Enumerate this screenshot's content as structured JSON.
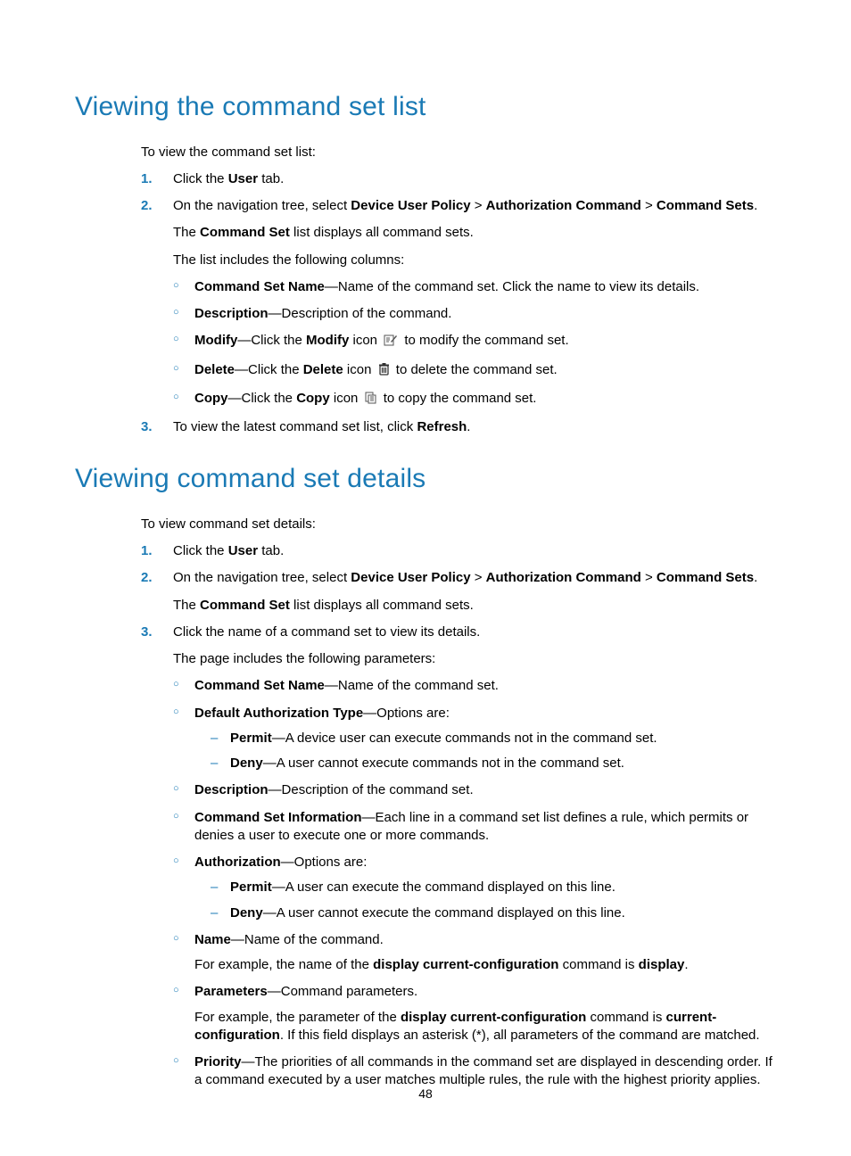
{
  "page_number": "48",
  "s1": {
    "heading": "Viewing the command set list",
    "intro": "To view the command set list:",
    "step1_a": "Click the ",
    "step1_b": "User",
    "step1_c": " tab.",
    "step2_a": "On the navigation tree, select ",
    "step2_b": "Device User Policy",
    "step2_gt1": " > ",
    "step2_c": "Authorization Command",
    "step2_gt2": " > ",
    "step2_d": "Command Sets",
    "step2_e": ".",
    "step2_p2a": "The ",
    "step2_p2b": "Command Set",
    "step2_p2c": " list displays all command sets.",
    "step2_p3": "The list includes the following columns:",
    "col_name_b": "Command Set Name",
    "col_name_t": "—Name of the command set. Click the name to view its details.",
    "col_desc_b": "Description",
    "col_desc_t": "—Description of the command.",
    "col_mod_b": "Modify",
    "col_mod_t1": "—Click the ",
    "col_mod_b2": "Modify",
    "col_mod_t2": " icon ",
    "col_mod_t3": " to modify the command set.",
    "col_del_b": "Delete",
    "col_del_t1": "—Click the ",
    "col_del_b2": "Delete",
    "col_del_t2": " icon ",
    "col_del_t3": " to delete the command set.",
    "col_copy_b": "Copy",
    "col_copy_t1": "—Click the ",
    "col_copy_b2": "Copy",
    "col_copy_t2": " icon ",
    "col_copy_t3": " to copy the command set.",
    "step3_a": "To view the latest command set list, click ",
    "step3_b": "Refresh",
    "step3_c": "."
  },
  "s2": {
    "heading": "Viewing command set details",
    "intro": "To view command set details:",
    "step1_a": "Click the ",
    "step1_b": "User",
    "step1_c": " tab.",
    "step2_a": "On the navigation tree, select ",
    "step2_b": "Device User Policy",
    "step2_gt1": " > ",
    "step2_c": "Authorization Command",
    "step2_gt2": " > ",
    "step2_d": "Command Sets",
    "step2_e": ".",
    "step2_p2a": "The ",
    "step2_p2b": "Command Set",
    "step2_p2c": " list displays all command sets.",
    "step3": "Click the name of a command set to view its details.",
    "step3_p2": "The page includes the following parameters:",
    "p_name_b": "Command Set Name",
    "p_name_t": "—Name of the command set.",
    "p_dat_b": "Default Authorization Type",
    "p_dat_t": "—Options are:",
    "dat_permit_b": "Permit",
    "dat_permit_t": "—A device user can execute commands not in the command set.",
    "dat_deny_b": "Deny",
    "dat_deny_t": "—A user cannot execute commands not in the command set.",
    "p_desc_b": "Description",
    "p_desc_t": "—Description of the command set.",
    "p_csi_b": "Command Set Information",
    "p_csi_t": "—Each line in a command set list defines a rule, which permits or denies a user to execute one or more commands.",
    "p_auth_b": "Authorization",
    "p_auth_t": "—Options are:",
    "auth_permit_b": "Permit",
    "auth_permit_t": "—A user can execute the command displayed on this line.",
    "auth_deny_b": "Deny",
    "auth_deny_t": "—A user cannot execute the command displayed on this line.",
    "p_cmdname_b": "Name",
    "p_cmdname_t": "—Name of the command.",
    "p_cmdname_ex_a": "For example, the name of the ",
    "p_cmdname_ex_b": "display current-configuration",
    "p_cmdname_ex_c": " command is ",
    "p_cmdname_ex_d": "display",
    "p_cmdname_ex_e": ".",
    "p_params_b": "Parameters",
    "p_params_t": "—Command parameters.",
    "p_params_ex_a": "For example, the parameter of the ",
    "p_params_ex_b": "display current-configuration",
    "p_params_ex_c": " command is ",
    "p_params_ex_d": "current-configuration",
    "p_params_ex_e": ". If this field displays an asterisk (*), all parameters of the command are matched.",
    "p_prio_b": "Priority",
    "p_prio_t": "—The priorities of all commands in the command set are displayed in descending order. If a command executed by a user matches multiple rules, the rule with the highest priority applies."
  }
}
